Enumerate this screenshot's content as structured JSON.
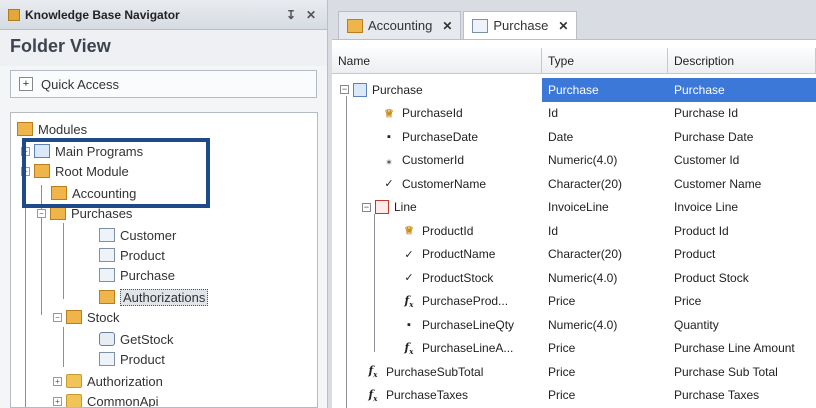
{
  "left_panel": {
    "title": "Knowledge Base Navigator",
    "pin": "↧",
    "close": "✕",
    "folder_view": "Folder View",
    "quick_access": "Quick Access",
    "quick_access_icon": "+",
    "tree": [
      {
        "label": "Modules",
        "icon": "modules-icon"
      },
      {
        "label": "Main Programs",
        "icon": "folder-icon"
      },
      {
        "label": "Root Module",
        "icon": "module-icon"
      },
      {
        "label": "Accounting",
        "icon": "module-icon"
      },
      {
        "label": "Purchases",
        "icon": "module-icon"
      },
      {
        "label": "Customer",
        "icon": "transaction-icon"
      },
      {
        "label": "Product",
        "icon": "transaction-icon"
      },
      {
        "label": "Purchase",
        "icon": "transaction-icon"
      },
      {
        "label": "Authorizations",
        "icon": "module-icon",
        "selected": true
      },
      {
        "label": "Stock",
        "icon": "module-icon"
      },
      {
        "label": "GetStock",
        "icon": "procedure-icon"
      },
      {
        "label": "Product",
        "icon": "transaction-icon"
      },
      {
        "label": "Authorization",
        "icon": "folder-icon"
      },
      {
        "label": "CommonApi",
        "icon": "folder-icon"
      }
    ]
  },
  "tabs": [
    {
      "label": "Accounting",
      "close": "✕",
      "icon": "module-icon"
    },
    {
      "label": "Purchase",
      "close": "✕",
      "icon": "transaction-icon",
      "active": true
    }
  ],
  "grid": {
    "headers": [
      "Name",
      "Type",
      "Description"
    ],
    "rows": [
      {
        "name": "Purchase",
        "type": "Purchase",
        "desc": "Purchase",
        "glyph": "transaction-icon",
        "selected": true
      },
      {
        "name": "PurchaseId",
        "type": "Id",
        "desc": "Purchase Id",
        "glyph": "key-icon"
      },
      {
        "name": "PurchaseDate",
        "type": "Date",
        "desc": "Purchase Date",
        "glyph": "square-bullet-icon"
      },
      {
        "name": "CustomerId",
        "type": "Numeric(4.0)",
        "desc": "Customer Id",
        "glyph": "foreign-key-icon"
      },
      {
        "name": "CustomerName",
        "type": "Character(20)",
        "desc": "Customer Name",
        "glyph": "inferred-icon"
      },
      {
        "name": "Line",
        "type": "InvoiceLine",
        "desc": "Invoice Line",
        "glyph": "level-icon"
      },
      {
        "name": "ProductId",
        "type": "Id",
        "desc": "Product Id",
        "glyph": "key-icon"
      },
      {
        "name": "ProductName",
        "type": "Character(20)",
        "desc": "Product",
        "glyph": "inferred-icon"
      },
      {
        "name": "ProductStock",
        "type": "Numeric(4.0)",
        "desc": "Product Stock",
        "glyph": "inferred-icon"
      },
      {
        "name": "PurchaseProd...",
        "type": "Price",
        "desc": "Price",
        "glyph": "formula-icon"
      },
      {
        "name": "PurchaseLineQty",
        "type": "Numeric(4.0)",
        "desc": "Quantity",
        "glyph": "square-bullet-icon"
      },
      {
        "name": "PurchaseLineA...",
        "type": "Price",
        "desc": "Purchase Line Amount",
        "glyph": "formula-icon"
      },
      {
        "name": "PurchaseSubTotal",
        "type": "Price",
        "desc": "Purchase Sub Total",
        "glyph": "formula-icon"
      },
      {
        "name": "PurchaseTaxes",
        "type": "Price",
        "desc": "Purchase Taxes",
        "glyph": "formula-icon"
      }
    ]
  },
  "colors": {
    "selection": "#3b78d8",
    "highlight_box": "#1f4a8a",
    "module": "#f0b54a"
  }
}
